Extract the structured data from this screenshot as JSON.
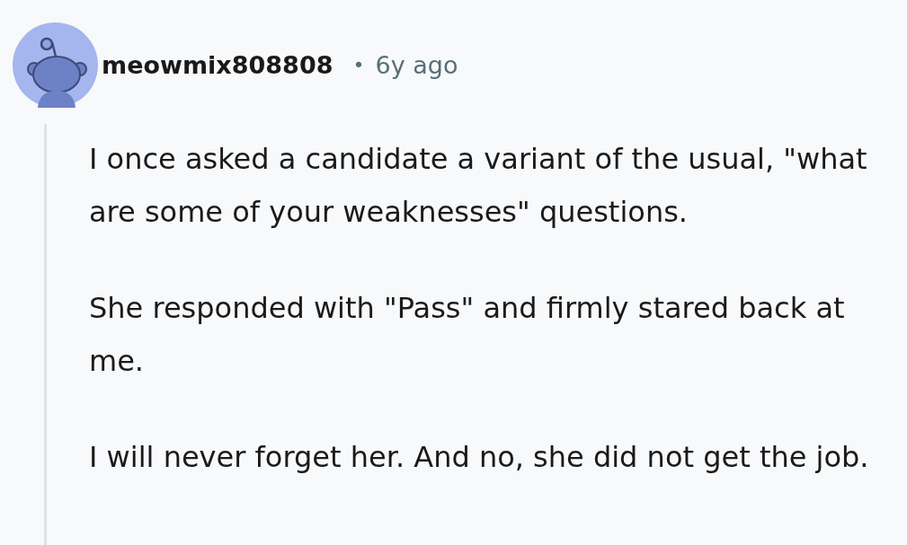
{
  "comment": {
    "author": "meowmix808808",
    "separator": "•",
    "time": "6y ago",
    "paragraphs": [
      "I once asked a candidate a variant of the usual, \"what are some of your weaknesses\" questions.",
      "She responded with \"Pass\" and firmly stared back at me.",
      "I will never forget her. And no, she did not get the job."
    ]
  }
}
